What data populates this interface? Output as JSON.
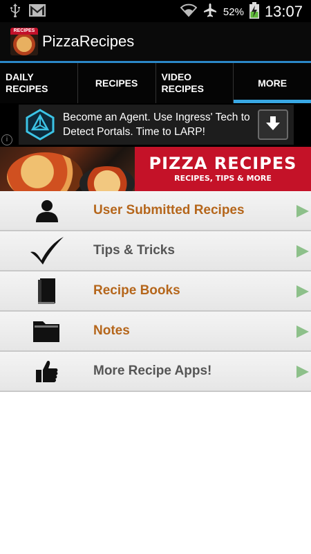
{
  "status_bar": {
    "icons": [
      "usb-icon",
      "gmail-icon",
      "wifi-icon",
      "airplane-icon",
      "battery-charging-icon"
    ],
    "battery": "52%",
    "time": "13:07"
  },
  "app": {
    "logo_text": "RECIPES",
    "title": "PizzaRecipes"
  },
  "tabs": [
    {
      "label": "DAILY RECIPES",
      "active": false
    },
    {
      "label": "RECIPES",
      "active": false
    },
    {
      "label": "VIDEO RECIPES",
      "active": false
    },
    {
      "label": "MORE",
      "active": true
    }
  ],
  "ad": {
    "text": "Become an Agent. Use Ingress' Tech to Detect Portals. Time to LARP!",
    "info_glyph": "i"
  },
  "banner": {
    "title": "PIZZA RECIPES",
    "subtitle": "RECIPES, TIPS & MORE"
  },
  "menu": [
    {
      "label": "User Submitted Recipes",
      "icon": "user-icon",
      "color": "#b5661b"
    },
    {
      "label": "Tips & Tricks",
      "icon": "checkmark-icon",
      "color": "#555555"
    },
    {
      "label": "Recipe Books",
      "icon": "book-icon",
      "color": "#b5661b"
    },
    {
      "label": "Notes",
      "icon": "folder-icon",
      "color": "#b5661b"
    },
    {
      "label": "More Recipe Apps!",
      "icon": "thumbs-up-icon",
      "color": "#555555"
    }
  ],
  "colors": {
    "accent": "#39a8e4",
    "banner_red": "#c41228",
    "arrow": "#8dc08a"
  }
}
